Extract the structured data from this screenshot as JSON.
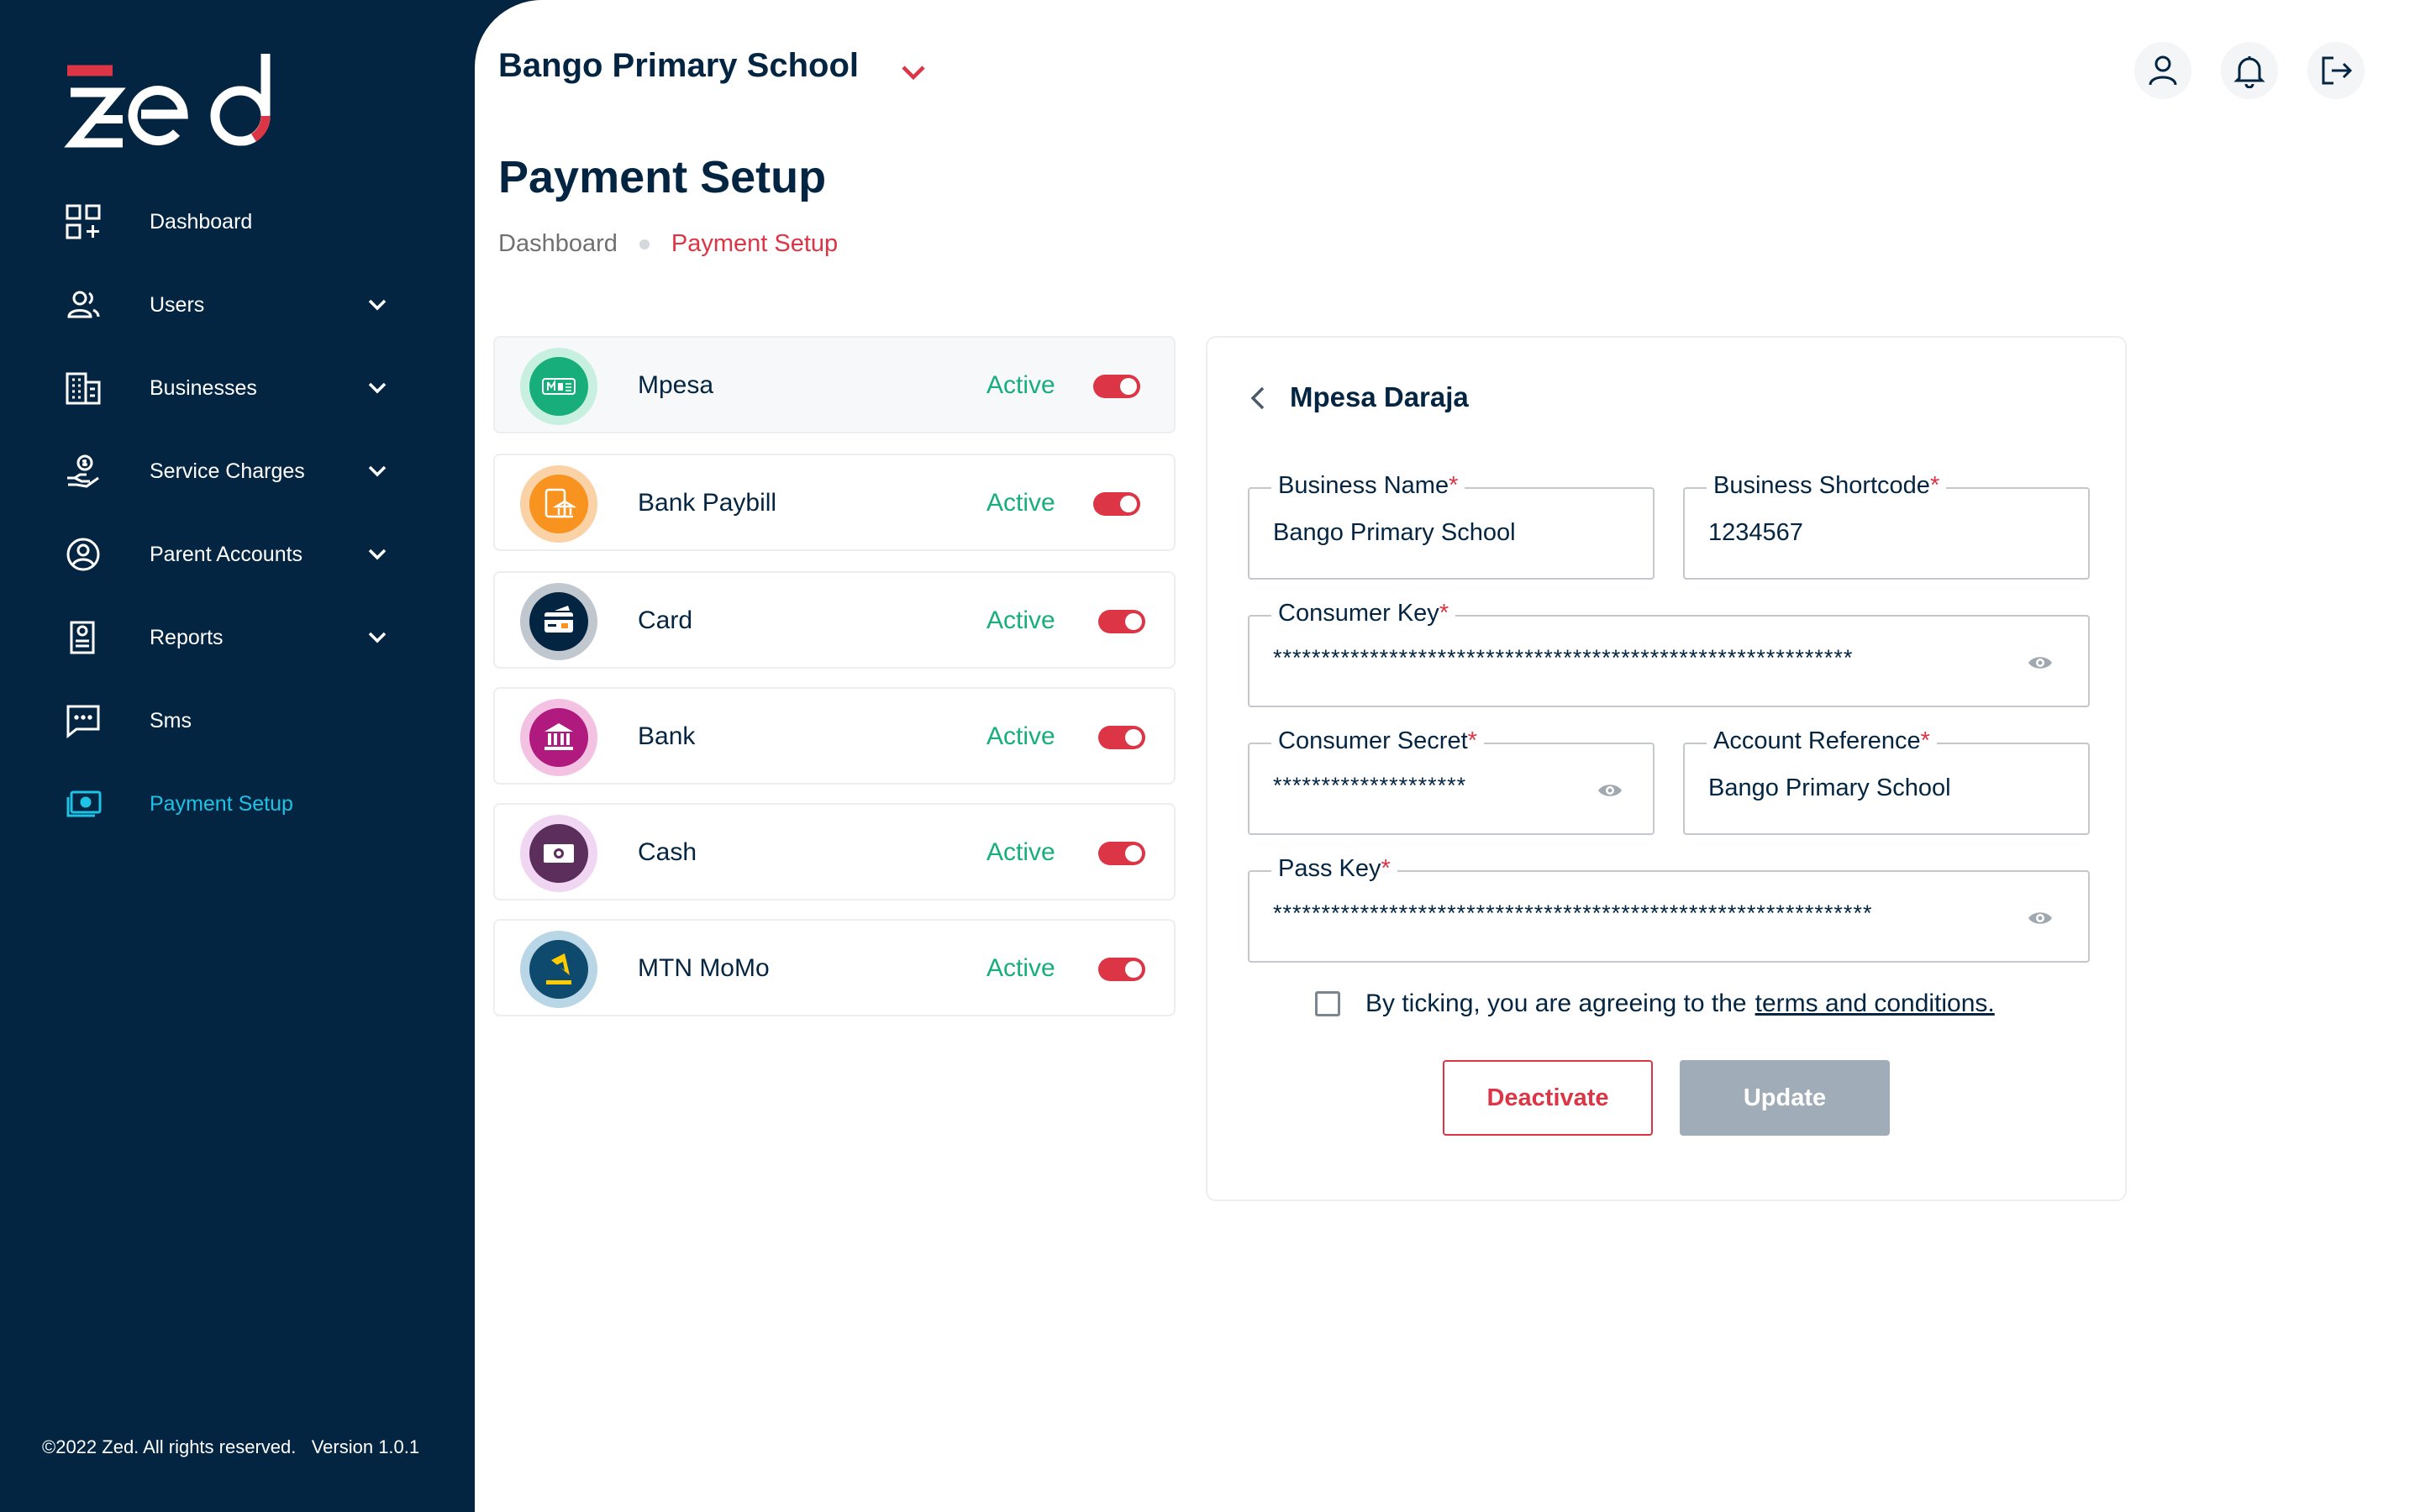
{
  "brand": {
    "accent": "#dc3545",
    "sidebar_bg": "#032541",
    "active_nav": "#1fc2e4",
    "success": "#17ae7b"
  },
  "sidebar": {
    "items": [
      {
        "label": "Dashboard",
        "icon": "dashboard-icon",
        "has_chevron": false
      },
      {
        "label": "Users",
        "icon": "users-icon",
        "has_chevron": true
      },
      {
        "label": "Businesses",
        "icon": "businesses-icon",
        "has_chevron": true
      },
      {
        "label": "Service Charges",
        "icon": "service-charges-icon",
        "has_chevron": true
      },
      {
        "label": "Parent Accounts",
        "icon": "parent-accounts-icon",
        "has_chevron": true
      },
      {
        "label": "Reports",
        "icon": "reports-icon",
        "has_chevron": true
      },
      {
        "label": "Sms",
        "icon": "sms-icon",
        "has_chevron": false
      },
      {
        "label": "Payment Setup",
        "icon": "payment-setup-icon",
        "has_chevron": false,
        "active": true
      }
    ],
    "footer": "©2022 Zed. All rights reserved.   Version 1.0.1"
  },
  "header": {
    "school_name": "Bango Primary School",
    "icons": [
      "user-icon",
      "bell-icon",
      "logout-icon"
    ]
  },
  "page": {
    "title": "Payment Setup",
    "breadcrumb": [
      "Dashboard",
      "Payment Setup"
    ]
  },
  "payment_methods": [
    {
      "name": "Mpesa",
      "status": "Active",
      "icon": "mpesa-icon",
      "color": "#17ae7b"
    },
    {
      "name": "Bank Paybill",
      "status": "Active",
      "icon": "bank-paybill-icon",
      "color": "#f7931e"
    },
    {
      "name": "Card",
      "status": "Active",
      "icon": "card-icon",
      "color": "#032541"
    },
    {
      "name": "Bank",
      "status": "Active",
      "icon": "bank-icon",
      "color": "#b01a7f"
    },
    {
      "name": "Cash",
      "status": "Active",
      "icon": "cash-icon",
      "color": "#5b2e5c"
    },
    {
      "name": "MTN MoMo",
      "status": "Active",
      "icon": "mtn-momo-icon",
      "color": "#0e4a6e"
    }
  ],
  "details": {
    "title": "Mpesa Daraja",
    "business_name_label": "Business Name",
    "business_name_value": "Bango Primary School",
    "business_shortcode_label": "Business Shortcode",
    "business_shortcode_value": "1234567",
    "consumer_key_label": "Consumer Key",
    "consumer_key_value": "************************************************************",
    "consumer_secret_label": "Consumer Secret",
    "consumer_secret_value": "********************",
    "account_reference_label": "Account Reference",
    "account_reference_value": "Bango Primary School",
    "pass_key_label": "Pass Key",
    "pass_key_value": "**************************************************************",
    "required_mark": "*",
    "terms_text": "By ticking, you are agreeing to the",
    "terms_link": "terms and conditions.",
    "deactivate_label": "Deactivate",
    "update_label": "Update"
  }
}
